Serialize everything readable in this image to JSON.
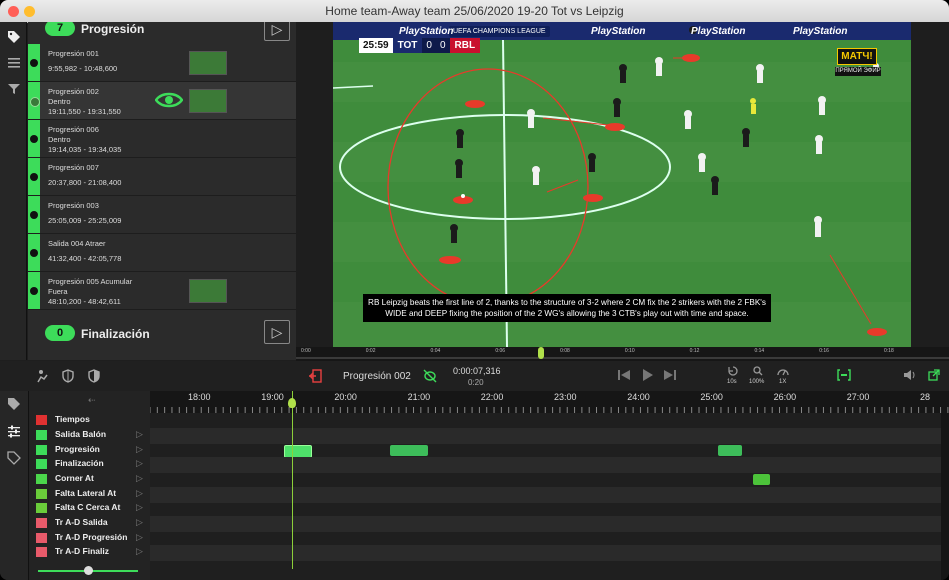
{
  "window": {
    "title": "Home team-Away team 25/06/2020 19-20 Tot vs Leipzig"
  },
  "sidebar_icons": [
    "tag-icon",
    "list-icon",
    "filter-icon"
  ],
  "categories": [
    {
      "count": "7",
      "name": "Progresión"
    },
    {
      "count": "0",
      "name": "Finalización"
    }
  ],
  "events": [
    {
      "title": "Progresión 001",
      "line2": "",
      "time": "9:55,982 - 10:48,600",
      "thumb": true,
      "selected": false
    },
    {
      "title": "Progresión 002",
      "line2": "Dentro",
      "time": "19:11,550 - 19:31,550",
      "thumb": true,
      "selected": true
    },
    {
      "title": "Progresión 006",
      "line2": "Dentro",
      "time": "19:14,035 - 19:34,035",
      "thumb": false,
      "selected": false
    },
    {
      "title": "Progresión 007",
      "line2": "",
      "time": "20:37,800 - 21:08,400",
      "thumb": false,
      "selected": false
    },
    {
      "title": "Progresión 003",
      "line2": "",
      "time": "25:05,009 - 25:25,009",
      "thumb": false,
      "selected": false
    },
    {
      "title": "Salida  004 Atraer",
      "line2": "",
      "time": "41:32,400 - 42:05,778",
      "thumb": false,
      "selected": false
    },
    {
      "title": "Progresión 005 Acumular",
      "line2": "Fuera",
      "time": "48:10,200 - 48:42,611",
      "thumb": true,
      "selected": false
    }
  ],
  "video": {
    "scorebug": {
      "clock": "25:59",
      "home": "TOT",
      "home_score": "0",
      "away_score": "0",
      "away": "RBL"
    },
    "competition": "UEFA CHAMPIONS LEAGUE",
    "sponsor": "PlayStation",
    "channel": "МАТЧ!",
    "channel_sub": "ПРЯМОЙ ЭФИР",
    "caption": "RB Leipzig beats the first  line of  2, thanks to the structure of  3-2 where 2 CM fix the 2 strikers with the 2 FBK's  WIDE and DEEP fixing the  position of the 2  WG's allowing the 3 CTB's  play out with time and  space."
  },
  "scrubber": {
    "ticks": [
      "0:00",
      "0:02",
      "0:04",
      "0:06",
      "0:08",
      "0:10",
      "0:12",
      "0:14",
      "0:16",
      "0:18"
    ],
    "position": 0.37
  },
  "transport": {
    "clip_name": "Progresión 002",
    "time": "0:00:07,316",
    "duration": "0:20",
    "skip_label": "10s",
    "zoom_label": "100%",
    "speed_label": "1X"
  },
  "timeline": {
    "ruler": [
      "18:00",
      "19:00",
      "20:00",
      "21:00",
      "22:00",
      "23:00",
      "24:00",
      "25:00",
      "26:00",
      "27:00",
      "28"
    ],
    "rows": [
      {
        "name": "Tiempos",
        "color": "#e03131"
      },
      {
        "name": "Salida Balón",
        "color": "#3ddc5a"
      },
      {
        "name": "Progresión",
        "color": "#3ddc5a"
      },
      {
        "name": "Finalización",
        "color": "#3ddc5a"
      },
      {
        "name": "Corner At",
        "color": "#3ddc5a"
      },
      {
        "name": "Falta Lateral At",
        "color": "#3ddc5a"
      },
      {
        "name": "Falta C Cerca At",
        "color": "#3ddc5a"
      },
      {
        "name": "Tr A-D Salida",
        "color": "#e85a6a"
      },
      {
        "name": "Tr A-D Progresión",
        "color": "#e85a6a"
      },
      {
        "name": "Tr A-D Finaliz",
        "color": "#e85a6a"
      }
    ]
  }
}
